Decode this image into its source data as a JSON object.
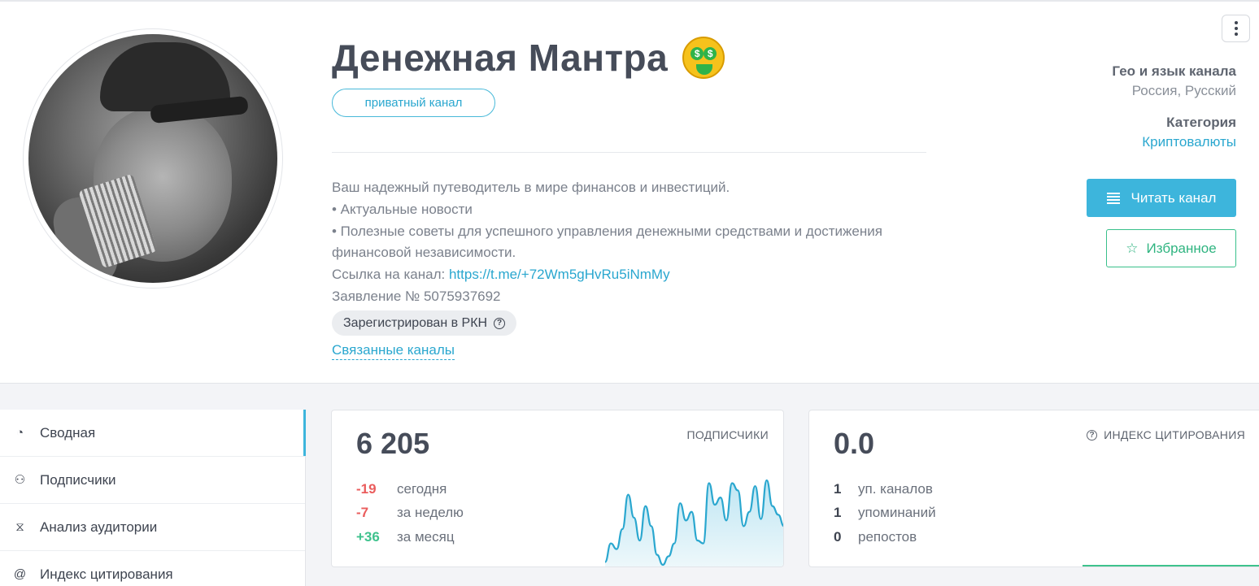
{
  "channel": {
    "title": "Денежная Мантра",
    "emoji_icon": "money-mouth-face-icon",
    "badge": "приватный канал",
    "description_lines": [
      "Ваш надежный путеводитель в мире финансов и инвестиций.",
      "• Актуальные новости",
      "• Полезные советы для успешного управления денежными средствами и достижения финансовой независимости."
    ],
    "link_label": "Ссылка на канал:",
    "link_url": "https://t.me/+72Wm5gHvRu5iNmMy",
    "application": "Заявление № 5075937692",
    "rkn_label": "Зарегистрирован в РКН",
    "related_label": "Связанные каналы"
  },
  "meta": {
    "geo_heading": "Гео и язык канала",
    "geo_value": "Россия, Русский",
    "category_heading": "Категория",
    "category_value": "Криптовалюты"
  },
  "actions": {
    "read_label": "Читать канал",
    "favorite_label": "Избранное"
  },
  "sidebar": {
    "items": [
      {
        "label": "Сводная",
        "icon": "dashboard-icon"
      },
      {
        "label": "Подписчики",
        "icon": "users-icon"
      },
      {
        "label": "Анализ аудитории",
        "icon": "dna-icon"
      },
      {
        "label": "Индекс цитирования",
        "icon": "at-icon"
      }
    ]
  },
  "subscribers": {
    "label": "ПОДПИСЧИКИ",
    "total": "6 205",
    "rows": [
      {
        "value": "-19",
        "text": "сегодня"
      },
      {
        "value": "-7",
        "text": "за неделю"
      },
      {
        "value": "+36",
        "text": "за месяц"
      }
    ]
  },
  "citation": {
    "label": "ИНДЕКС ЦИТИРОВАНИЯ",
    "value": "0.0",
    "rows": [
      {
        "value": "1",
        "text": "уп. каналов"
      },
      {
        "value": "1",
        "text": "упоминаний"
      },
      {
        "value": "0",
        "text": "репостов"
      }
    ]
  },
  "colors": {
    "accent": "#3db5dc",
    "negative": "#ea5c5c",
    "positive": "#3ec28d"
  },
  "chart_data": {
    "type": "area",
    "values": [
      5,
      18,
      14,
      28,
      52,
      36,
      20,
      44,
      30,
      10,
      3,
      9,
      18,
      46,
      34,
      40,
      20,
      18,
      60,
      45,
      50,
      34,
      60,
      55,
      30,
      40,
      58,
      35,
      62,
      44,
      38,
      30
    ]
  }
}
